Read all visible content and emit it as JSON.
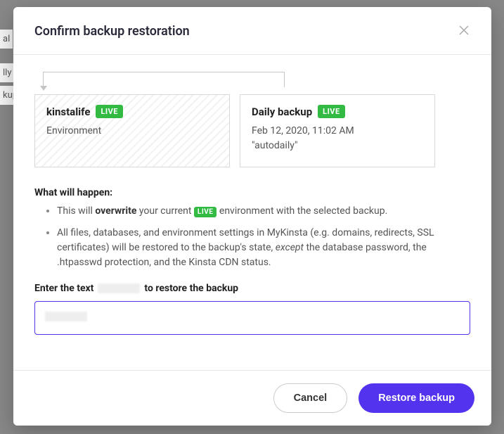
{
  "modal": {
    "title": "Confirm backup restoration"
  },
  "env_card": {
    "name": "kinstalife",
    "badge": "LIVE",
    "label": "Environment"
  },
  "backup_card": {
    "title": "Daily backup",
    "badge": "LIVE",
    "timestamp": "Feb 12, 2020, 11:02 AM",
    "tag": "\"autodaily\""
  },
  "happen": {
    "heading": "What will happen:",
    "line1_a": "This will ",
    "line1_strong": "overwrite",
    "line1_b": " your current ",
    "line1_badge": "LIVE",
    "line1_c": " environment with the selected backup.",
    "line2_a": "All files, databases, and environment settings in MyKinsta (e.g. domains, redirects, SSL certificates) will be restored to the backup's state, ",
    "line2_em": "except",
    "line2_b": " the database password, the .htpasswd protection, and the Kinsta CDN status."
  },
  "confirm": {
    "prefix": "Enter the text",
    "suffix": "to restore the backup"
  },
  "footer": {
    "cancel": "Cancel",
    "restore": "Restore backup"
  }
}
